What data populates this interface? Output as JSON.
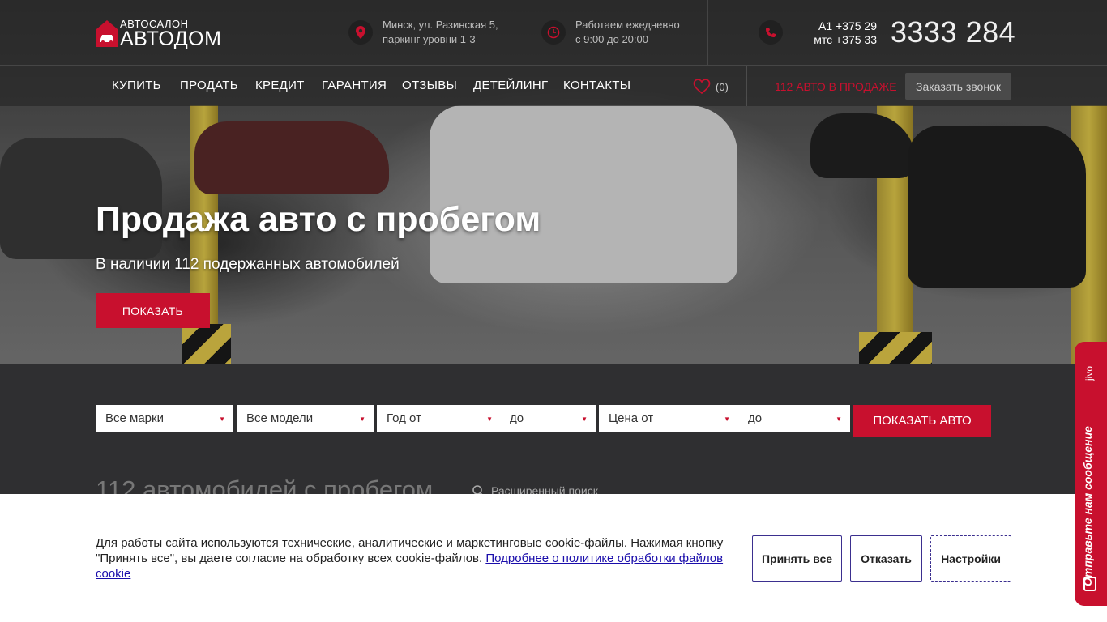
{
  "header": {
    "logo_top": "АВТОСАЛОН",
    "logo_main": "АВТОДОМ",
    "address_line1": "Минск, ул. Разинская 5,",
    "address_line2": "паркинг уровни 1-3",
    "hours_line1": "Работаем ежедневно",
    "hours_line2": "с 9:00 до 20:00",
    "phone_a1": "A1 +375 29",
    "phone_mts": "мтс +375 33",
    "phone_number": "3333 284"
  },
  "nav": {
    "items": [
      "КУПИТЬ",
      "ПРОДАТЬ",
      "КРЕДИТ",
      "ГАРАНТИЯ",
      "ОТЗЫВЫ",
      "ДЕТЕЙЛИНГ",
      "КОНТАКТЫ"
    ],
    "favorites_count": "(0)",
    "in_sale": "112 АВТО В ПРОДАЖЕ",
    "callback": "Заказать звонок"
  },
  "hero": {
    "title": "Продажа авто с пробегом",
    "subtitle": "В наличии 112 подержанных автомобилей",
    "button": "ПОКАЗАТЬ"
  },
  "search": {
    "brand": "Все марки",
    "model": "Все модели",
    "year_from": "Год от",
    "year_to": "до",
    "price_from": "Цена от",
    "price_to": "до",
    "submit": "ПОКАЗАТЬ АВТО",
    "count_title": "112 автомобилей с пробегом",
    "advanced": "Расширенный поиск"
  },
  "cookie": {
    "text": "Для работы сайта используются технические, аналитические и маркетинговые cookie-файлы. Нажимая кнопку \"Принять все\", вы даете согласие на обработку всех cookie-файлов. ",
    "link": "Подробнее о политике обработки файлов cookie",
    "accept": "Принять все",
    "decline": "Отказать",
    "settings": "Настройки"
  },
  "jivo": {
    "label": "Отправьте нам сообщение",
    "brand": "jivo"
  },
  "colors": {
    "accent": "#c8102e",
    "dark": "#2f2f31"
  }
}
